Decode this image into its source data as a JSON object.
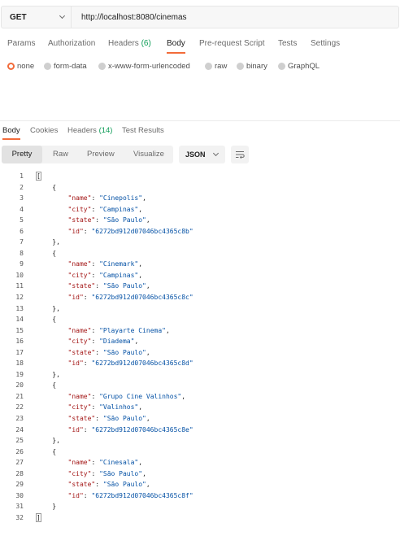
{
  "request": {
    "method": "GET",
    "url": "http://localhost:8080/cinemas"
  },
  "request_tabs": [
    {
      "label": "Params"
    },
    {
      "label": "Authorization"
    },
    {
      "label": "Headers",
      "count": "(6)"
    },
    {
      "label": "Body"
    },
    {
      "label": "Pre-request Script"
    },
    {
      "label": "Tests"
    },
    {
      "label": "Settings"
    }
  ],
  "body_types": [
    {
      "label": "none",
      "selected": true
    },
    {
      "label": "form-data",
      "selected": false
    },
    {
      "label": "x-www-form-urlencoded",
      "selected": false
    },
    {
      "label": "raw",
      "selected": false
    },
    {
      "label": "binary",
      "selected": false
    },
    {
      "label": "GraphQL",
      "selected": false
    }
  ],
  "response_tabs": [
    {
      "label": "Body"
    },
    {
      "label": "Cookies"
    },
    {
      "label": "Headers",
      "count": "(14)"
    },
    {
      "label": "Test Results"
    }
  ],
  "view_modes": [
    "Pretty",
    "Raw",
    "Preview",
    "Visualize"
  ],
  "format": "JSON",
  "response_json": [
    {
      "name": "Cinepolis",
      "city": "Campinas",
      "state": "São Paulo",
      "id": "6272bd912d07046bc4365c8b"
    },
    {
      "name": "Cinemark",
      "city": "Campinas",
      "state": "São Paulo",
      "id": "6272bd912d07046bc4365c8c"
    },
    {
      "name": "Playarte Cinema",
      "city": "Diadema",
      "state": "São Paulo",
      "id": "6272bd912d07046bc4365c8d"
    },
    {
      "name": "Grupo Cine Valinhos",
      "city": "Valinhos",
      "state": "São Paulo",
      "id": "6272bd912d07046bc4365c8e"
    },
    {
      "name": "Cinesala",
      "city": "São Paulo",
      "state": "São Paulo",
      "id": "6272bd912d07046bc4365c8f"
    }
  ],
  "colors": {
    "accent": "#f26b3a",
    "count_green": "#0f9d58",
    "json_key": "#a31515",
    "json_value": "#0451a5"
  }
}
